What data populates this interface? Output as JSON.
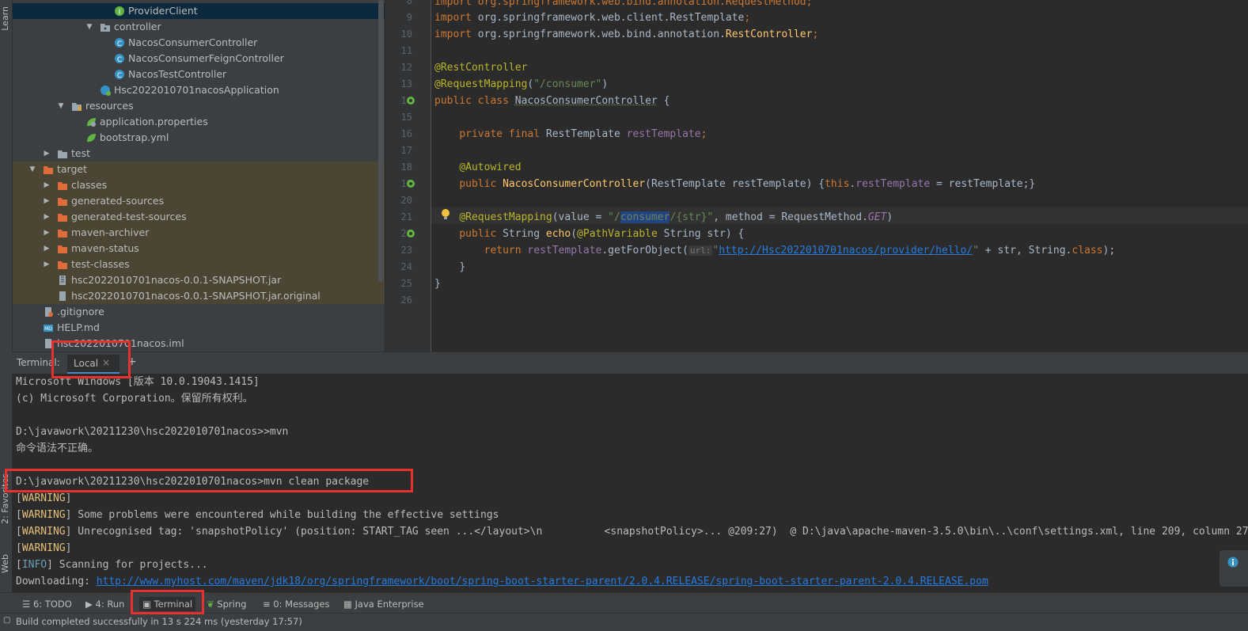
{
  "left_stripe": {
    "learn": "Learn",
    "favorites": "2: Favorites",
    "web": "Web"
  },
  "tree": [
    {
      "label": "ProviderClient",
      "icon": "interface-icon",
      "state": "selected"
    },
    {
      "label": "controller",
      "icon": "package-folder-icon",
      "arrow": "▼"
    },
    {
      "label": "NacosConsumerController",
      "icon": "class-icon"
    },
    {
      "label": "NacosConsumerFeignController",
      "icon": "class-icon"
    },
    {
      "label": "NacosTestController",
      "icon": "class-icon"
    },
    {
      "label": "Hsc2022010701nacosApplication",
      "icon": "spring-boot-class-icon"
    },
    {
      "label": "resources",
      "icon": "resources-folder-icon",
      "arrow": "▼"
    },
    {
      "label": "application.properties",
      "icon": "spring-config-icon"
    },
    {
      "label": "bootstrap.yml",
      "icon": "spring-leaf-icon"
    },
    {
      "label": "test",
      "icon": "folder-icon",
      "arrow": "▶"
    },
    {
      "label": "target",
      "icon": "excluded-folder-icon",
      "arrow": "▼",
      "state": "excluded"
    },
    {
      "label": "classes",
      "icon": "excluded-folder-icon",
      "arrow": "▶",
      "state": "excluded"
    },
    {
      "label": "generated-sources",
      "icon": "excluded-folder-icon",
      "arrow": "▶",
      "state": "excluded"
    },
    {
      "label": "generated-test-sources",
      "icon": "excluded-folder-icon",
      "arrow": "▶",
      "state": "excluded"
    },
    {
      "label": "maven-archiver",
      "icon": "excluded-folder-icon",
      "arrow": "▶",
      "state": "excluded"
    },
    {
      "label": "maven-status",
      "icon": "excluded-folder-icon",
      "arrow": "▶",
      "state": "excluded"
    },
    {
      "label": "test-classes",
      "icon": "excluded-folder-icon",
      "arrow": "▶",
      "state": "excluded"
    },
    {
      "label": "hsc2022010701nacos-0.0.1-SNAPSHOT.jar",
      "icon": "jar-icon",
      "state": "excluded"
    },
    {
      "label": "hsc2022010701nacos-0.0.1-SNAPSHOT.jar.original",
      "icon": "file-icon",
      "state": "excluded"
    },
    {
      "label": ".gitignore",
      "icon": "gitignore-icon"
    },
    {
      "label": "HELP.md",
      "icon": "markdown-icon"
    },
    {
      "label": "hsc2022010701nacos.iml",
      "icon": "iml-icon"
    }
  ],
  "editor": {
    "line_numbers": [
      "8",
      "9",
      "10",
      "11",
      "12",
      "13",
      "14",
      "15",
      "16",
      "17",
      "18",
      "19",
      "20",
      "21",
      "22",
      "23",
      "24",
      "25",
      "26"
    ],
    "line8": "import org.springframework.web.bind.annotation.RequestMethod;",
    "line9a": "import ",
    "line9b": "org.springframework.web.client.RestTemplate",
    "line10a": "import ",
    "line10b": "org.springframework.web.bind.annotation.",
    "line10c": "RestController",
    "anno_rest": "@RestController",
    "anno_rm": "@RequestMapping",
    "consumer_path": "\"/consumer\"",
    "public_class": "public class ",
    "class_name": "NacosConsumerController",
    "brace_open": " {",
    "private_final": "private final ",
    "rest_template_type": "RestTemplate ",
    "rest_template_field": "restTemplate",
    "autowired": "@Autowired",
    "public_kw": "public ",
    "ctor_name": "NacosConsumerController",
    "ctor_params": "(RestTemplate restTemplate) {",
    "this_kw": "this",
    "ctor_assign": " = restTemplate;}",
    "line21_anno": "@RequestMapping",
    "line21_value": "(value = ",
    "line21_q1": "\"/",
    "line21_hl": "consumer",
    "line21_q2": "/{str}\"",
    "line21_method": ", method = RequestMethod.",
    "line21_get": "GET",
    "line22_a": "public ",
    "line22_b": "String ",
    "line22_c": "echo",
    "line22_d": "(",
    "line22_e": "@PathVariable",
    "line22_f": " String str) {",
    "line23_ret": "return ",
    "line23_rt": "restTemplate",
    "line23_call": ".getForObject(",
    "line23_hint": "url:",
    "line23_url": "http://Hsc2022010701nacos/provider/hello/",
    "line23_rest": " + str, String.",
    "line23_class": "class",
    "close_inner": "}",
    "close_outer": "}"
  },
  "terminal": {
    "header_label": "Terminal:",
    "tab_label": "Local",
    "close_glyph": "×",
    "add_glyph": "+",
    "lines": [
      "Microsoft Windows [版本 10.0.19043.1415]",
      "(c) Microsoft Corporation。保留所有权利。",
      "",
      "D:\\javawork\\20211230\\hsc2022010701nacos>>mvn",
      "命令语法不正确。",
      "",
      "D:\\javawork\\20211230\\hsc2022010701nacos>mvn clean package"
    ],
    "warning_tag": "WARNING",
    "info_tag": "INFO",
    "warn2": " Some problems were encountered while building the effective settings",
    "warn3": " Unrecognised tag: 'snapshotPolicy' (position: START_TAG seen ...</layout>\\n          <snapshotPolicy>... @209:27)  @ D:\\java\\apache-maven-3.5.0\\bin\\..\\conf\\settings.xml, line 209, column 27",
    "info1": " Scanning for projects...",
    "downloading": "Downloading: ",
    "download_url": "http://www.myhost.com/maven/jdk18/org/springframework/boot/spring-boot-starter-parent/2.0.4.RELEASE/spring-boot-starter-parent-2.0.4.RELEASE.pom"
  },
  "toolbar": {
    "todo": "6: TODO",
    "run": "4: Run",
    "terminal": "Terminal",
    "spring": "Spring",
    "messages": "0: Messages",
    "java_enterprise": "Java Enterprise"
  },
  "status": {
    "text": "Build completed successfully in 13 s 224 ms (yesterday 17:57)"
  },
  "colors": {
    "highlight_box": "#e8312e",
    "keyword": "#cc7832",
    "annotation": "#bbb529",
    "string": "#6a8759",
    "link": "#287bde"
  }
}
